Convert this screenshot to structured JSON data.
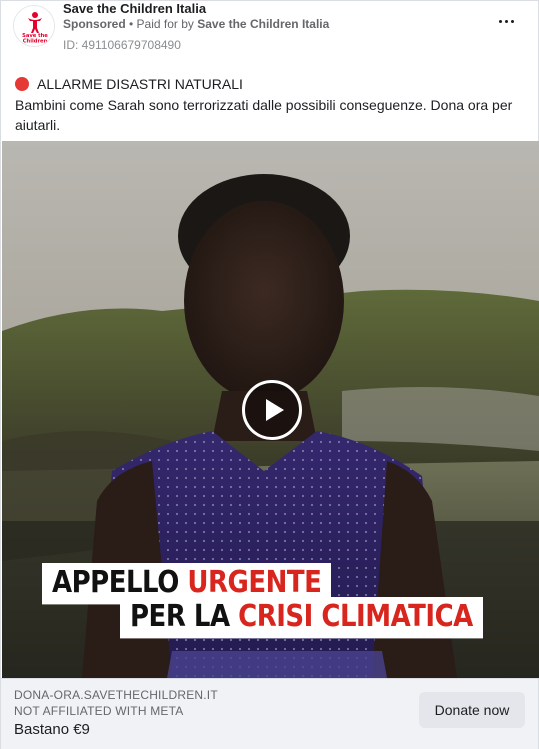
{
  "post": {
    "page_name": "Save the Children Italia",
    "sponsored": "Sponsored",
    "separator": " • ",
    "paid_for_prefix": "Paid for by ",
    "paid_for_by": "Save the Children Italia",
    "ad_id": "ID: 491106679708490",
    "logo_text_1": "Save the",
    "logo_text_2": "Children",
    "more_icon": "more-horizontal-icon"
  },
  "content": {
    "alert_icon": "red-circle-icon",
    "alert_title": "ALLARME DISASTRI NATURALI",
    "body": "Bambini come Sarah sono terrorizzati dalle possibili conseguenze. Dona ora per aiutarli."
  },
  "media": {
    "play_icon": "play-icon",
    "banner_line1_black": "APPELLO ",
    "banner_line1_red": "URGENTE",
    "banner_line2_black": "PER LA ",
    "banner_line2_red": "CRISI CLIMATICA",
    "colors": {
      "banner_red": "#d8261f",
      "banner_bg": "#ffffff"
    }
  },
  "footer": {
    "domain": "DONA-ORA.SAVETHECHILDREN.IT",
    "note": "NOT AFFILIATED WITH META",
    "price": "Bastano €9",
    "cta_label": "Donate now"
  }
}
